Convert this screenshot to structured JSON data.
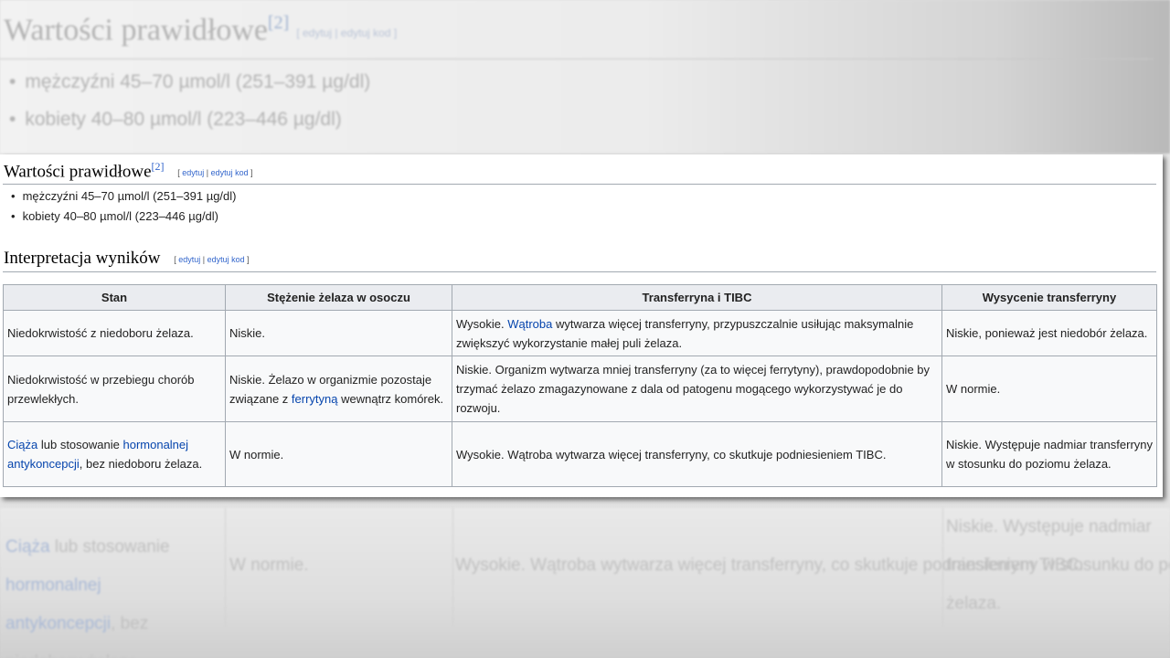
{
  "zoom": {
    "heading": "Wartości prawidłowe",
    "ref": "[2]",
    "edit": "[ edytuj | edytuj kod ]",
    "items": [
      "mężczyźni 45–70 µmol/l (251–391 µg/dl)",
      "kobiety 40–80 µmol/l (223–446 µg/dl)"
    ]
  },
  "normal": {
    "heading": "Wartości prawidłowe",
    "ref": "[2]",
    "edit_open": "[ ",
    "edit1": "edytuj",
    "edit_sep": " | ",
    "edit2": "edytuj kod",
    "edit_close": " ]",
    "items": [
      "mężczyźni 45–70 µmol/l (251–391 µg/dl)",
      "kobiety 40–80 µmol/l (223–446 µg/dl)"
    ]
  },
  "interp": {
    "heading": "Interpretacja wyników",
    "edit_open": "[ ",
    "edit1": "edytuj",
    "edit_sep": " | ",
    "edit2": "edytuj kod",
    "edit_close": " ]"
  },
  "table": {
    "headers": [
      "Stan",
      "Stężenie żelaza w osoczu",
      "Transferryna i TIBC",
      "Wysycenie transferryny"
    ],
    "rows": [
      {
        "stan": "Niedokrwistość z niedoboru żelaza.",
        "iron": "Niskie.",
        "tibc_pre": "Wysokie. ",
        "tibc_link": "Wątroba",
        "tibc_post": " wytwarza więcej transferryny, przypuszczalnie usiłując maksymalnie zwiększyć wykorzystanie małej puli żelaza.",
        "sat": "Niskie, ponieważ jest niedobór żelaza."
      },
      {
        "stan": "Niedokrwistość w przebiegu chorób przewlekłych.",
        "iron_pre": "Niskie. Żelazo w organizmie pozostaje związane z ",
        "iron_link": "ferrytyną",
        "iron_post": " wewnątrz komórek.",
        "tibc": "Niskie. Organizm wytwarza mniej transferryny (za to więcej ferrytyny), prawdopodobnie by trzymać żelazo zmagazynowane z dala od patogenu mogącego wykorzystywać je do rozwoju.",
        "sat": "W normie."
      },
      {
        "stan_link1": "Ciąża",
        "stan_mid": " lub stosowanie ",
        "stan_link2": "hormonalnej antykoncepcji",
        "stan_post": ", bez niedoboru żelaza.",
        "iron": "W normie.",
        "tibc": "Wysokie. Wątroba wytwarza więcej transferryny, co skutkuje podniesieniem TIBC.",
        "sat": "Niskie. Występuje nadmiar transferryny w stosunku do poziomu żelaza."
      }
    ]
  },
  "reflection": {
    "c1_link1": "Ciąża",
    "c1_mid": " lub stosowanie ",
    "c1_link2": "hormonalnej",
    "c1_link3": "antykoncepcji",
    "c1_post": ", bez niedoboru żelaza.",
    "c2": "W normie.",
    "c3": "Wysokie. Wątroba wytwarza więcej transferryny, co skutkuje podniesieniem TIBC.",
    "c4_l1": "Niskie. Występuje nadmiar",
    "c4_l2": "transferryny w stosunku do poziomu",
    "c4_l3": "żelaza."
  },
  "colors": {
    "link": "#0645ad",
    "border": "#a2a9b1",
    "header_bg": "#eaecf0",
    "cell_bg": "#f8f9fa"
  }
}
